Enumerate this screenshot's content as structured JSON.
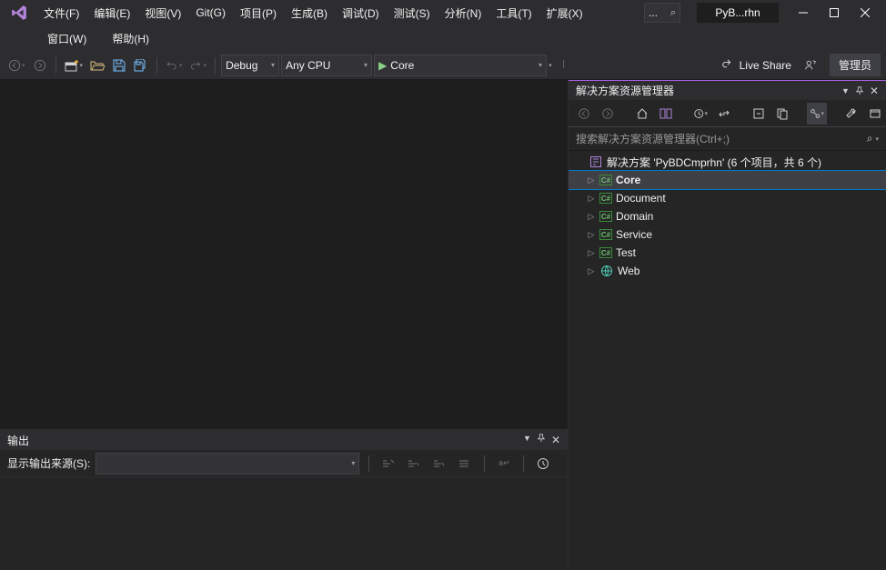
{
  "menus": {
    "file": "文件(F)",
    "edit": "编辑(E)",
    "view": "视图(V)",
    "git": "Git(G)",
    "project": "项目(P)",
    "build": "生成(B)",
    "debug": "调试(D)",
    "test": "测试(S)",
    "analyze": "分析(N)",
    "tools": "工具(T)",
    "extensions": "扩展(X)",
    "window": "窗口(W)",
    "help": "帮助(H)"
  },
  "search_ellipsis": "...",
  "title": "PyB...rhn",
  "toolbar": {
    "config": "Debug",
    "platform": "Any CPU",
    "startup": "Core",
    "liveshare": "Live Share",
    "admin": "管理员"
  },
  "output": {
    "title": "输出",
    "source_label": "显示输出来源(S):",
    "source_value": ""
  },
  "solution_explorer": {
    "title": "解决方案资源管理器",
    "search_placeholder": "搜索解决方案资源管理器(Ctrl+;)",
    "root": "解决方案 'PyBDCmprhn' (6 个项目，共 6 个)",
    "projects": [
      {
        "name": "Core",
        "type": "cs",
        "selected": true
      },
      {
        "name": "Document",
        "type": "cs"
      },
      {
        "name": "Domain",
        "type": "cs"
      },
      {
        "name": "Service",
        "type": "cs"
      },
      {
        "name": "Test",
        "type": "cs"
      },
      {
        "name": "Web",
        "type": "web"
      }
    ]
  }
}
